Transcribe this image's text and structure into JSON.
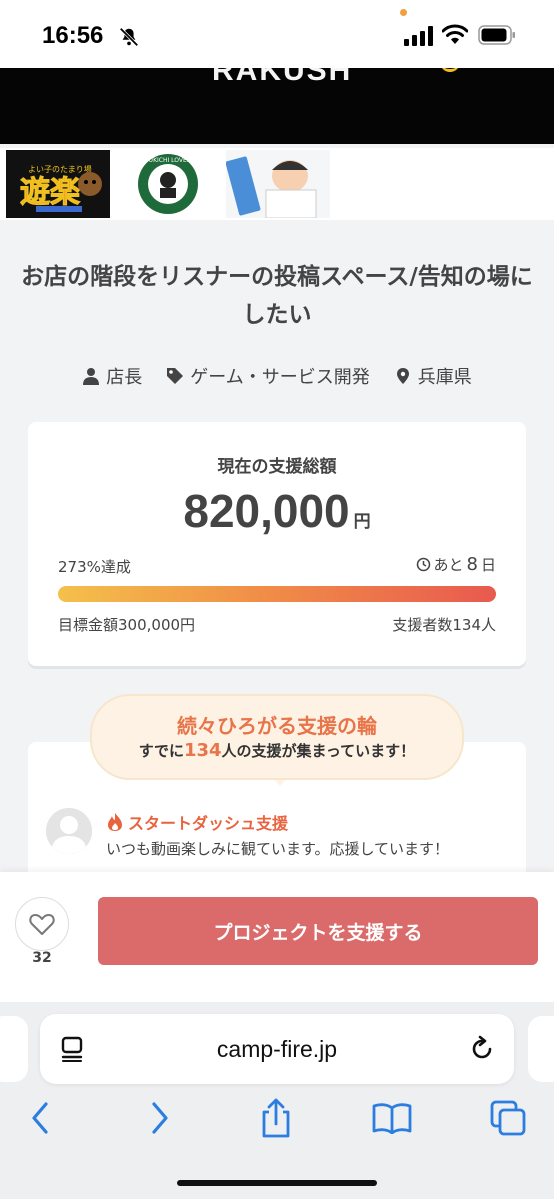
{
  "status": {
    "time": "16:56"
  },
  "hero": {
    "text": "RAKUSH"
  },
  "thumbnails": {
    "t1_small": "よい子のたまり場",
    "t1_main": "遊楽",
    "t2_text": "YUKICHI LOVER",
    "t3_alt": "illustration"
  },
  "project": {
    "title": "お店の階段をリスナーの投稿スペース/告知の場にしたい",
    "owner": "店長",
    "category": "ゲーム・サービス開発",
    "location": "兵庫県"
  },
  "funding": {
    "label": "現在の支援総額",
    "amount": "820,000",
    "currency": "円",
    "achievement_percent": "273",
    "achievement_suffix": "%達成",
    "remaining_prefix": "あと",
    "remaining_days": "8",
    "remaining_suffix": "日",
    "goal": "目標金額300,000円",
    "backers": "支援者数134人",
    "progress_fraction": 1.0
  },
  "supporters": {
    "bubble_title": "続々ひろがる支援の輪",
    "bubble_pre": "すでに",
    "bubble_count": "134",
    "bubble_post": "人の支援が集まっています！",
    "tag": "スタートダッシュ支援",
    "message": "いつも動画楽しみに観ています。応援しています！"
  },
  "actions": {
    "like_count": "32",
    "support_label": "プロジェクトを支援する"
  },
  "browser": {
    "url": "camp-fire.jp"
  },
  "colors": {
    "accent": "#e8744a",
    "button": "#db6b6b",
    "ios_blue": "#2b7de0"
  }
}
